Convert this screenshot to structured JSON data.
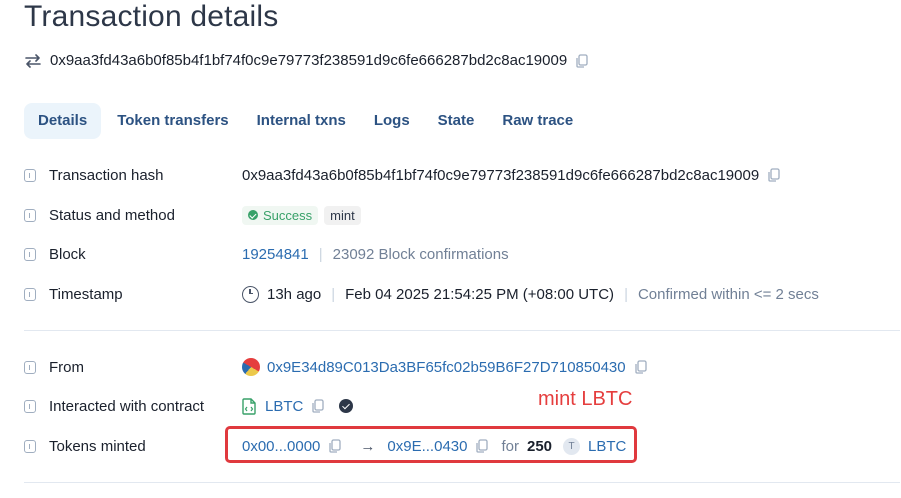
{
  "page": {
    "title": "Transaction details",
    "tx_hash": "0x9aa3fd43a6b0f85b4f1bf74f0c9e79773f238591d9c6fe666287bd2c8ac19009"
  },
  "tabs": [
    {
      "label": "Details",
      "active": true
    },
    {
      "label": "Token transfers"
    },
    {
      "label": "Internal txns"
    },
    {
      "label": "Logs"
    },
    {
      "label": "State"
    },
    {
      "label": "Raw trace"
    }
  ],
  "rows": {
    "tx_hash": {
      "label": "Transaction hash",
      "value": "0x9aa3fd43a6b0f85b4f1bf74f0c9e79773f238591d9c6fe666287bd2c8ac19009"
    },
    "status": {
      "label": "Status and method",
      "status": "Success",
      "method": "mint"
    },
    "block": {
      "label": "Block",
      "number": "19254841",
      "confirmations": "23092 Block confirmations"
    },
    "timestamp": {
      "label": "Timestamp",
      "relative": "13h ago",
      "absolute": "Feb 04 2025 21:54:25 PM (+08:00 UTC)",
      "confirmed": "Confirmed within <= 2 secs"
    },
    "from": {
      "label": "From",
      "address": "0x9E34d89C013Da3BF65fc02b59B6F27D710850430"
    },
    "contract": {
      "label": "Interacted with contract",
      "name": "LBTC"
    },
    "minted": {
      "label": "Tokens minted",
      "from": "0x00...0000",
      "to": "0x9E...0430",
      "for_label": "for",
      "amount": "250",
      "token_letter": "T",
      "token": "LBTC"
    }
  },
  "annotation": {
    "text": "mint LBTC",
    "color": "#e53e3e"
  },
  "colors": {
    "link": "#2b6cb0",
    "success": "#38a169",
    "highlight": "#e0393e"
  }
}
